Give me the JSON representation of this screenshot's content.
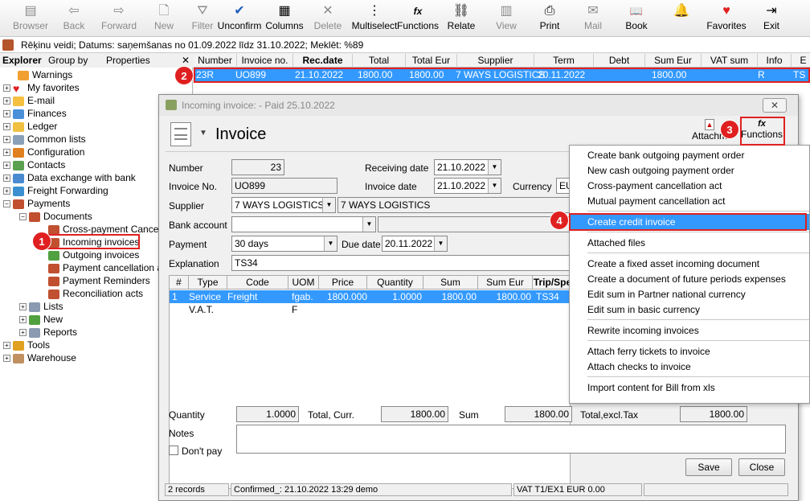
{
  "toolbar": [
    {
      "label": "Browser",
      "icon": "browser-icon",
      "glyph": "▤",
      "disabled": true
    },
    {
      "label": "Back",
      "icon": "back-icon",
      "glyph": "⇦",
      "disabled": true
    },
    {
      "label": "Forward",
      "icon": "forward-icon",
      "glyph": "⇨",
      "disabled": true
    },
    {
      "label": "New",
      "icon": "new-icon",
      "glyph": "🗋",
      "disabled": true
    },
    {
      "label": "Filter",
      "icon": "filter-icon",
      "glyph": "⛛",
      "disabled": true
    },
    {
      "label": "Unconfirm",
      "icon": "unconfirm-icon",
      "glyph": "✔",
      "disabled": false
    },
    {
      "label": "Columns",
      "icon": "columns-icon",
      "glyph": "▦",
      "disabled": false
    },
    {
      "label": "Delete",
      "icon": "delete-icon",
      "glyph": "✕",
      "disabled": true
    },
    {
      "label": "Multiselect",
      "icon": "multiselect-icon",
      "glyph": "⋮",
      "disabled": false
    },
    {
      "label": "Functions",
      "icon": "functions-icon",
      "glyph": "fx",
      "disabled": false
    },
    {
      "label": "Relate",
      "icon": "relate-icon",
      "glyph": "⛓",
      "disabled": false
    },
    {
      "label": "View",
      "icon": "view-icon",
      "glyph": "▥",
      "disabled": true
    },
    {
      "label": "Print",
      "icon": "print-icon",
      "glyph": "⎙",
      "disabled": false
    },
    {
      "label": "Mail",
      "icon": "mail-icon",
      "glyph": "✉",
      "disabled": true
    },
    {
      "label": "Book",
      "icon": "book-icon",
      "glyph": "📖",
      "disabled": false
    },
    {
      "label": "",
      "icon": "bell-icon",
      "glyph": "🔔",
      "disabled": false
    },
    {
      "label": "Favorites",
      "icon": "heart-icon",
      "glyph": "♥",
      "disabled": false
    },
    {
      "label": "Exit",
      "icon": "exit-icon",
      "glyph": "⇥",
      "disabled": false
    }
  ],
  "status_bar": "Rēķinu veidi; Datums: saņemšanas no 01.09.2022 līdz 31.10.2022; Meklēt: %89",
  "explorer": {
    "tab_explorer": "Explorer",
    "tab_group": "Group by",
    "tab_props": "Properties",
    "close": "✕"
  },
  "tree": [
    {
      "label": "Warnings",
      "icon": "warnings-icon",
      "color": "#f0a030",
      "expander": ""
    },
    {
      "label": "My favorites",
      "icon": "heart-icon",
      "color": "#e02020",
      "expander": "+"
    },
    {
      "label": "E-mail",
      "icon": "mail-icon",
      "color": "#f5c040",
      "expander": "+"
    },
    {
      "label": "Finances",
      "icon": "folder-icon",
      "color": "#4a90d9",
      "expander": "+"
    },
    {
      "label": "Ledger",
      "icon": "folder-icon",
      "color": "#f0c040",
      "expander": "+"
    },
    {
      "label": "Common lists",
      "icon": "folder-icon",
      "color": "#8aa0b8",
      "expander": "+"
    },
    {
      "label": "Configuration",
      "icon": "gear-icon",
      "color": "#e08020",
      "expander": "+"
    },
    {
      "label": "Contacts",
      "icon": "folder-icon",
      "color": "#5aa050",
      "expander": "+"
    },
    {
      "label": "Data exchange with bank",
      "icon": "folder-icon",
      "color": "#4a8ad0",
      "expander": "+"
    },
    {
      "label": "Freight Forwarding",
      "icon": "folder-icon",
      "color": "#3a90d0",
      "expander": "+"
    },
    {
      "label": "Payments",
      "icon": "folder-icon",
      "color": "#c05030",
      "expander": "−"
    },
    {
      "label": "Documents",
      "icon": "folder-icon",
      "color": "#c05030",
      "expander": "−"
    },
    {
      "label": "Cross-payment Cancellation",
      "icon": "doc-icon",
      "color": "#c05030",
      "expander": ""
    },
    {
      "label": "Incoming invoices",
      "icon": "doc-icon",
      "color": "#c05030",
      "expander": ""
    },
    {
      "label": "Outgoing invoices",
      "icon": "doc-icon",
      "color": "#50a040",
      "expander": ""
    },
    {
      "label": "Payment cancellation a",
      "icon": "doc-icon",
      "color": "#c05030",
      "expander": ""
    },
    {
      "label": "Payment Reminders",
      "icon": "doc-icon",
      "color": "#c05030",
      "expander": ""
    },
    {
      "label": "Reconciliation acts",
      "icon": "doc-icon",
      "color": "#c05030",
      "expander": ""
    },
    {
      "label": "Lists",
      "icon": "list-icon",
      "color": "#8a9ab0",
      "expander": "+"
    },
    {
      "label": "New",
      "icon": "new-icon",
      "color": "#50a040",
      "expander": "+"
    },
    {
      "label": "Reports",
      "icon": "list-icon",
      "color": "#8a9ab0",
      "expander": "+"
    },
    {
      "label": "Tools",
      "icon": "tools-icon",
      "color": "#e0a020",
      "expander": "+"
    },
    {
      "label": "Warehouse",
      "icon": "folder-icon",
      "color": "#c09060",
      "expander": "+"
    }
  ],
  "grid": {
    "headers": [
      "Number",
      "Invoice no.",
      "Rec.date",
      "Total",
      "Total Eur",
      "Supplier",
      "Term",
      "Debt",
      "Sum Eur",
      "VAT sum Eur",
      "Info",
      "E"
    ],
    "row": [
      "23R",
      "UO899",
      "21.10.2022",
      "1800.00",
      "1800.00",
      "7 WAYS LOGISTICS",
      "20.11.2022",
      "",
      "1800.00",
      "",
      "R",
      "TS"
    ]
  },
  "dialog": {
    "title": "Incoming invoice:  - Paid 25.10.2022",
    "heading": "Invoice",
    "attachments": "Attachm",
    "functions": "Functions",
    "fields": {
      "number_label": "Number",
      "number": "23",
      "invoice_no_label": "Invoice No.",
      "invoice_no": "UO899",
      "supplier_label": "Supplier",
      "supplier_code": "7 WAYS LOGISTICS",
      "supplier_name": "7 WAYS LOGISTICS",
      "bank_label": "Bank account",
      "bank": "",
      "payment_label": "Payment",
      "payment": "30 days",
      "due_label": "Due date",
      "due": "20.11.2022",
      "expl_label": "Explanation",
      "expl": "TS34",
      "recv_label": "Receiving date",
      "recv": "21.10.2022",
      "invdate_label": "Invoice date",
      "invdate": "21.10.2022",
      "currency_label": "Currency",
      "currency": "EU"
    },
    "items_headers": [
      "#",
      "Type",
      "Code",
      "UOM",
      "Price",
      "Quantity",
      "Sum",
      "Sum Eur",
      "Trip/Spe"
    ],
    "items": [
      [
        "1",
        "Service",
        "Freight",
        "fgab.",
        "1800.000",
        "1.0000",
        "1800.00",
        "1800.00",
        "TS34"
      ],
      [
        "",
        "V.A.T.",
        "",
        "F",
        "",
        "",
        "",
        "",
        ""
      ]
    ],
    "totals": {
      "qty_label": "Quantity",
      "qty": "1.0000",
      "total_curr_label": "Total, Curr.",
      "total_curr": "1800.00",
      "sum_label": "Sum",
      "sum": "1800.00",
      "total_excl_label": "Total,excl.Tax",
      "total_excl": "1800.00"
    },
    "notes_label": "Notes",
    "dont_pay": "Don't pay",
    "save": "Save",
    "close": "Close",
    "status": [
      "2 records",
      "Confirmed_: 21.10.2022 13:29 demo",
      "VAT T1/EX1 EUR 0.00"
    ]
  },
  "menu": {
    "groups": [
      [
        "Create bank outgoing payment order",
        "New cash outgoing payment order",
        "Cross-payment cancellation act",
        "Mutual payment cancellation act"
      ],
      [
        "Create credit invoice"
      ],
      [
        "Attached files"
      ],
      [
        "Create a fixed asset incoming document",
        "Create a document of future periods expenses",
        "Edit sum in Partner national currency",
        "Edit sum in basic currency"
      ],
      [
        "Rewrite incoming invoices"
      ],
      [
        "Attach ferry tickets to invoice",
        "Attach checks to invoice"
      ],
      [
        "Import content for Bill from xls"
      ]
    ],
    "highlighted": "Create credit invoice"
  },
  "badges": [
    "1",
    "2",
    "3",
    "4"
  ],
  "accent": "#3399ff",
  "marker": "#e02020"
}
